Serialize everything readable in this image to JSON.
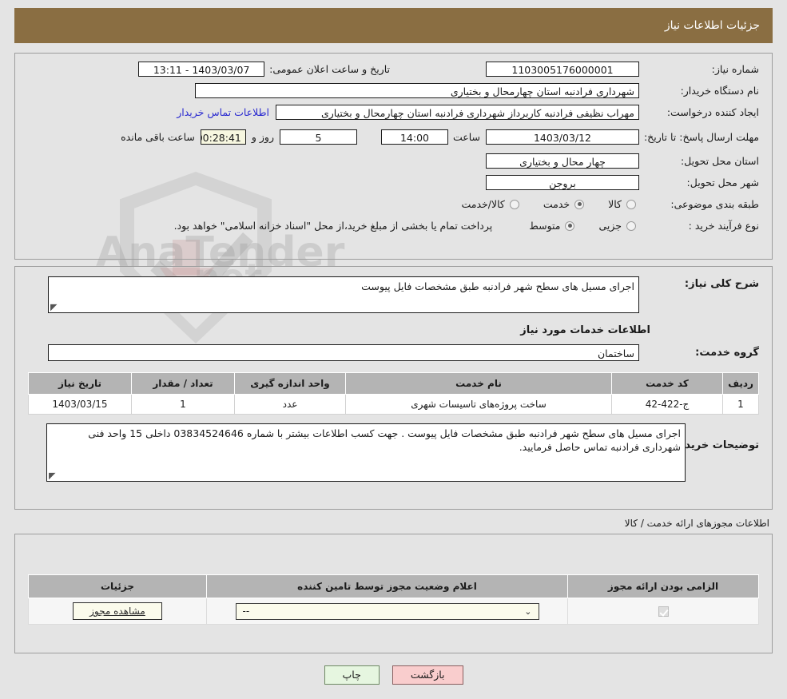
{
  "header": {
    "title": "جزئیات اطلاعات نیاز"
  },
  "top": {
    "need_number_label": "شماره نیاز:",
    "need_number_value": "1103005176000001",
    "announce_label": "تاریخ و ساعت اعلان عمومی:",
    "announce_value": "1403/03/07 - 13:11",
    "buyer_org_label": "نام دستگاه خریدار:",
    "buyer_org_value": "شهرداری فرادنبه استان چهارمحال و بختیاری",
    "creator_label": "ایجاد کننده درخواست:",
    "creator_value": "مهراب نظیفی فرادنبه کاربرداز شهرداری فرادنبه استان چهارمحال و بختیاری",
    "contact_link": "اطلاعات تماس خریدار",
    "deadline_label": "مهلت ارسال پاسخ: تا تاریخ:",
    "deadline_date": "1403/03/12",
    "hour_label": "ساعت",
    "deadline_time": "14:00",
    "days_value": "5",
    "days_label": "روز و",
    "remaining_value": "00:28:41",
    "remaining_label": "ساعت باقی مانده",
    "province_label": "استان محل تحویل:",
    "province_value": "چهار محال و بختیاری",
    "city_label": "شهر محل تحویل:",
    "city_value": "بروجن",
    "category_label": "طبقه بندی موضوعی:",
    "category_options": [
      "کالا",
      "خدمت",
      "کالا/خدمت"
    ],
    "category_selected": "خدمت",
    "process_label": "نوع فرآیند خرید :",
    "process_options": [
      "جزیی",
      "متوسط"
    ],
    "process_selected": "متوسط",
    "process_note": "پرداخت تمام یا بخشی از مبلغ خرید،از محل \"اسناد خزانه اسلامی\" خواهد بود."
  },
  "mid": {
    "need_desc_label": "شرح کلی نیاز:",
    "need_desc_value": "اجرای مسیل های سطح شهر فرادنبه طبق مشخصات فایل پیوست",
    "services_heading": "اطلاعات خدمات مورد نیاز",
    "service_group_label": "گروه خدمت:",
    "service_group_value": "ساختمان",
    "table": {
      "columns": [
        "ردیف",
        "کد خدمت",
        "نام خدمت",
        "واحد اندازه گیری",
        "تعداد / مقدار",
        "تاریخ نیاز"
      ],
      "rows": [
        [
          "1",
          "ج-422-42",
          "ساخت پروژه‌های تاسیسات شهری",
          "عدد",
          "1",
          "1403/03/15"
        ]
      ]
    },
    "buyer_notes_label": "توضیحات خریدار:",
    "buyer_notes_value": "اجرای مسیل های سطح شهر فرادنبه طبق مشخصات فایل پیوست . جهت کسب اطلاعات بیشتر با شماره 03834524646 داخلی 15 واحد فنی شهرداری فرادنبه تماس حاصل فرمایید."
  },
  "permits": {
    "caption": "اطلاعات مجوزهای ارائه خدمت / کالا",
    "columns": [
      "الزامی بودن ارائه مجوز",
      "اعلام وضعیت مجوز توسط تامین کننده",
      "جزئیات"
    ],
    "row": {
      "required_checked": true,
      "status_value": "--",
      "details_button": "مشاهده مجوز"
    }
  },
  "footer": {
    "back_label": "بازگشت",
    "print_label": "چاپ"
  },
  "watermark": {
    "text": "AnaTender",
    "text2": ".net"
  },
  "colors": {
    "header_bg": "#8a6e42",
    "link": "#2a2ad0",
    "table_header": "#b4b4b4",
    "back_btn": "#f9cdcd",
    "print_btn": "#e6f6e0"
  }
}
